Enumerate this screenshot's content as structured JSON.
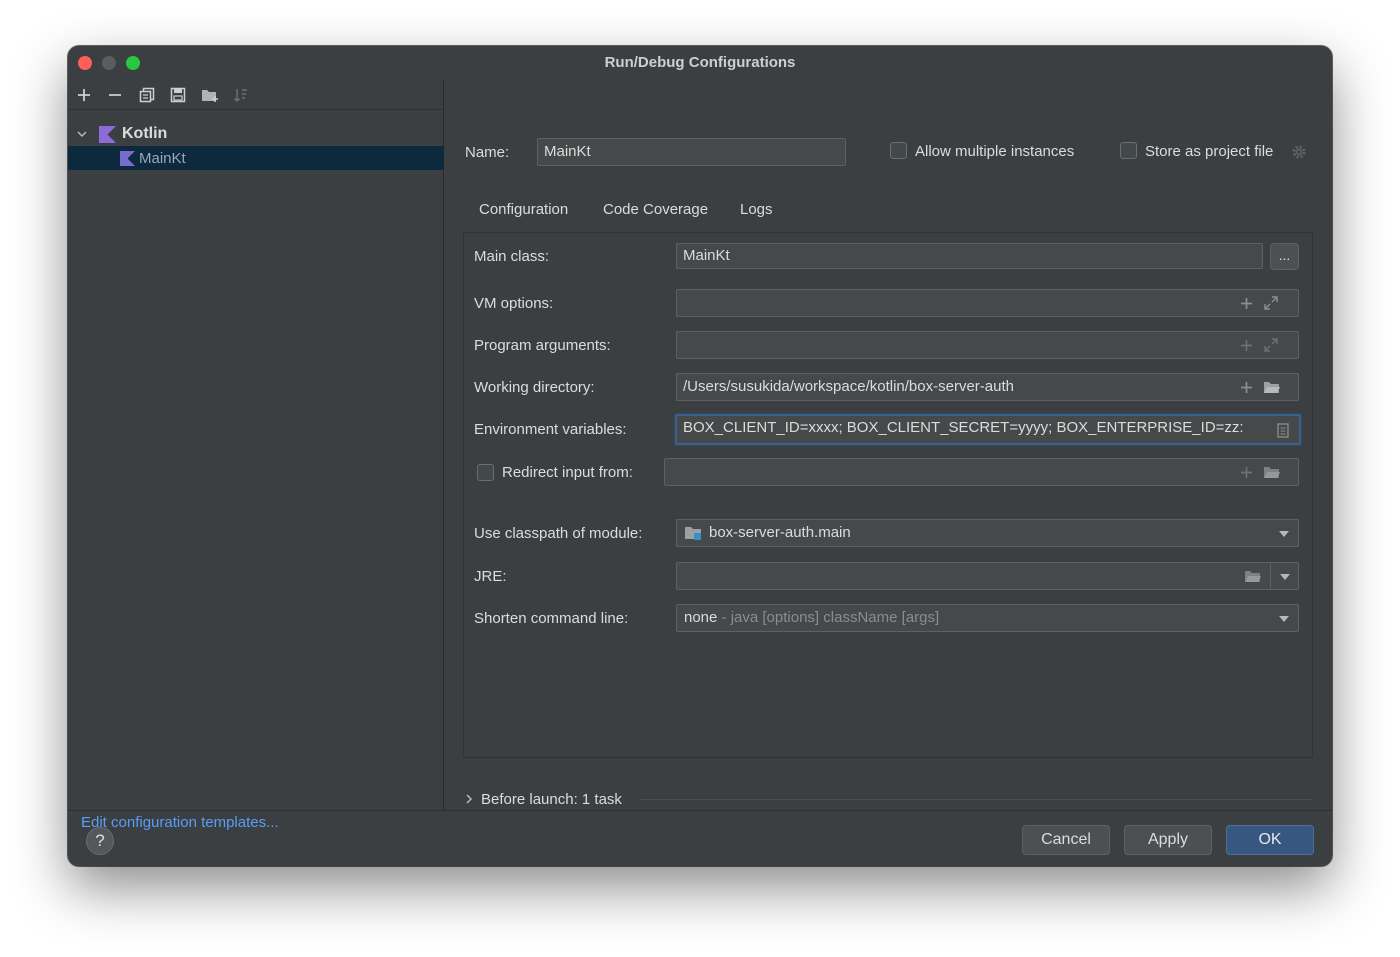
{
  "window": {
    "title": "Run/Debug Configurations"
  },
  "toolbar": {
    "icons": [
      "add-icon",
      "remove-icon",
      "copy-icon",
      "save-icon",
      "new-folder-icon",
      "sort-icon"
    ]
  },
  "tree": {
    "group": {
      "label": "Kotlin",
      "expanded": true,
      "icon": "kotlin-icon"
    },
    "items": [
      {
        "label": "MainKt",
        "selected": true,
        "icon": "kotlin-file-icon"
      }
    ]
  },
  "left_footer": {
    "edit_templates": "Edit configuration templates..."
  },
  "name_row": {
    "label": "Name:",
    "value": "MainKt",
    "allow_multiple_label": "Allow multiple instances",
    "allow_multiple_checked": false,
    "store_project_label": "Store as project file",
    "store_project_checked": false
  },
  "tabs": [
    {
      "label": "Configuration",
      "active": true
    },
    {
      "label": "Code Coverage",
      "active": false
    },
    {
      "label": "Logs",
      "active": false
    }
  ],
  "form": {
    "main_class": {
      "label": "Main class:",
      "value": "MainKt",
      "browse_label": "..."
    },
    "vm_options": {
      "label": "VM options:",
      "value": ""
    },
    "program_args": {
      "label": "Program arguments:",
      "value": ""
    },
    "working_dir": {
      "label": "Working directory:",
      "value": "/Users/susukida/workspace/kotlin/box-server-auth"
    },
    "env_vars": {
      "label": "Environment variables:",
      "value": "BOX_CLIENT_ID=xxxx; BOX_CLIENT_SECRET=yyyy; BOX_ENTERPRISE_ID=zz:"
    },
    "redirect": {
      "label": "Redirect input from:",
      "checked": false,
      "value": ""
    },
    "classpath": {
      "label": "Use classpath of module:",
      "value": "box-server-auth.main"
    },
    "jre": {
      "label": "JRE:",
      "value": ""
    },
    "shorten": {
      "label": "Shorten command line:",
      "value": "none",
      "hint": "- java [options] className [args]"
    }
  },
  "before_launch": {
    "label": "Before launch: 1 task"
  },
  "buttons": {
    "help": "?",
    "cancel": "Cancel",
    "apply": "Apply",
    "ok": "OK"
  },
  "colors": {
    "accent": "#4a88c7",
    "link": "#589df6",
    "primary_button": "#365880",
    "selection": "#0d293e"
  }
}
